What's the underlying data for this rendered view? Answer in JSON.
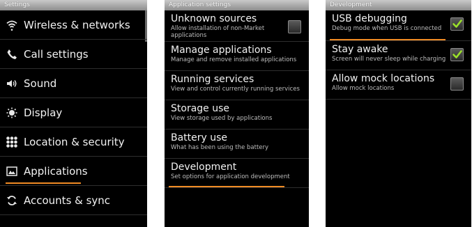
{
  "settings": {
    "title": "Settings",
    "items": [
      {
        "label": "Wireless & networks",
        "icon": "wifi-icon"
      },
      {
        "label": "Call settings",
        "icon": "phone-icon"
      },
      {
        "label": "Sound",
        "icon": "speaker-icon"
      },
      {
        "label": "Display",
        "icon": "brightness-icon"
      },
      {
        "label": "Location & security",
        "icon": "grid-lock-icon"
      },
      {
        "label": "Applications",
        "icon": "applications-icon",
        "selected": true
      },
      {
        "label": "Accounts & sync",
        "icon": "sync-icon"
      }
    ]
  },
  "application_settings": {
    "title": "Application settings",
    "items": [
      {
        "title": "Unknown sources",
        "summary": "Allow installation of non-Market applications",
        "checkbox": true,
        "checked": false
      },
      {
        "title": "Manage applications",
        "summary": "Manage and remove installed applications"
      },
      {
        "title": "Running services",
        "summary": "View and control currently running services"
      },
      {
        "title": "Storage use",
        "summary": "View storage used by applications"
      },
      {
        "title": "Battery use",
        "summary": "What has been using the battery"
      },
      {
        "title": "Development",
        "summary": "Set options for application development",
        "selected": true
      }
    ]
  },
  "development": {
    "title": "Development",
    "items": [
      {
        "title": "USB debugging",
        "summary": "Debug mode when USB is connected",
        "checked": true,
        "selected": true
      },
      {
        "title": "Stay awake",
        "summary": "Screen will never sleep while charging",
        "checked": true
      },
      {
        "title": "Allow mock locations",
        "summary": "Allow mock locations",
        "checked": false
      }
    ]
  },
  "colors": {
    "accent_underline": "#f08b24",
    "checkmark": "#9be12a",
    "background": "#000000"
  }
}
